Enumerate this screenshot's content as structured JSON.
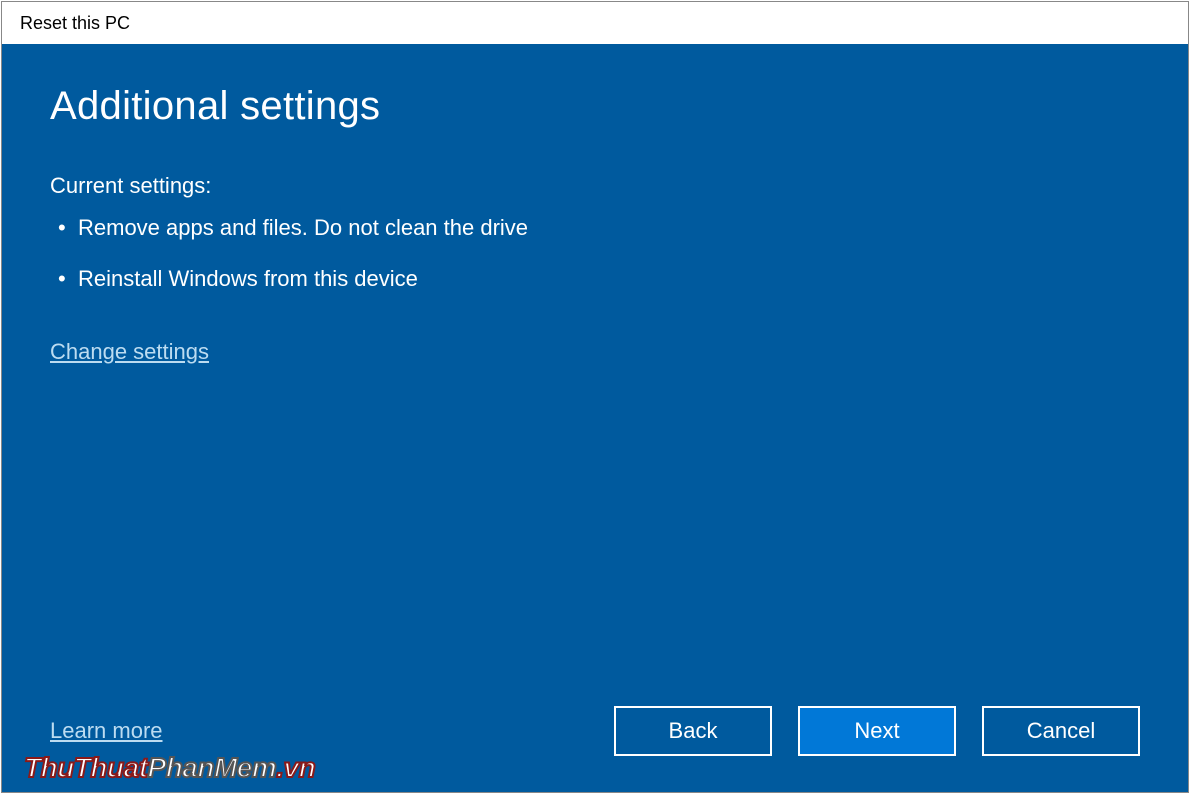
{
  "window": {
    "title": "Reset this PC"
  },
  "main": {
    "heading": "Additional settings",
    "subheading": "Current settings:",
    "settings": [
      "Remove apps and files. Do not clean the drive",
      "Reinstall Windows from this device"
    ],
    "change_link": "Change settings"
  },
  "footer": {
    "learn_more": "Learn more",
    "back": "Back",
    "next": "Next",
    "cancel": "Cancel"
  },
  "watermark": {
    "part1": "ThuThuat",
    "part2": "PhanMem",
    "part3": ".vn"
  }
}
